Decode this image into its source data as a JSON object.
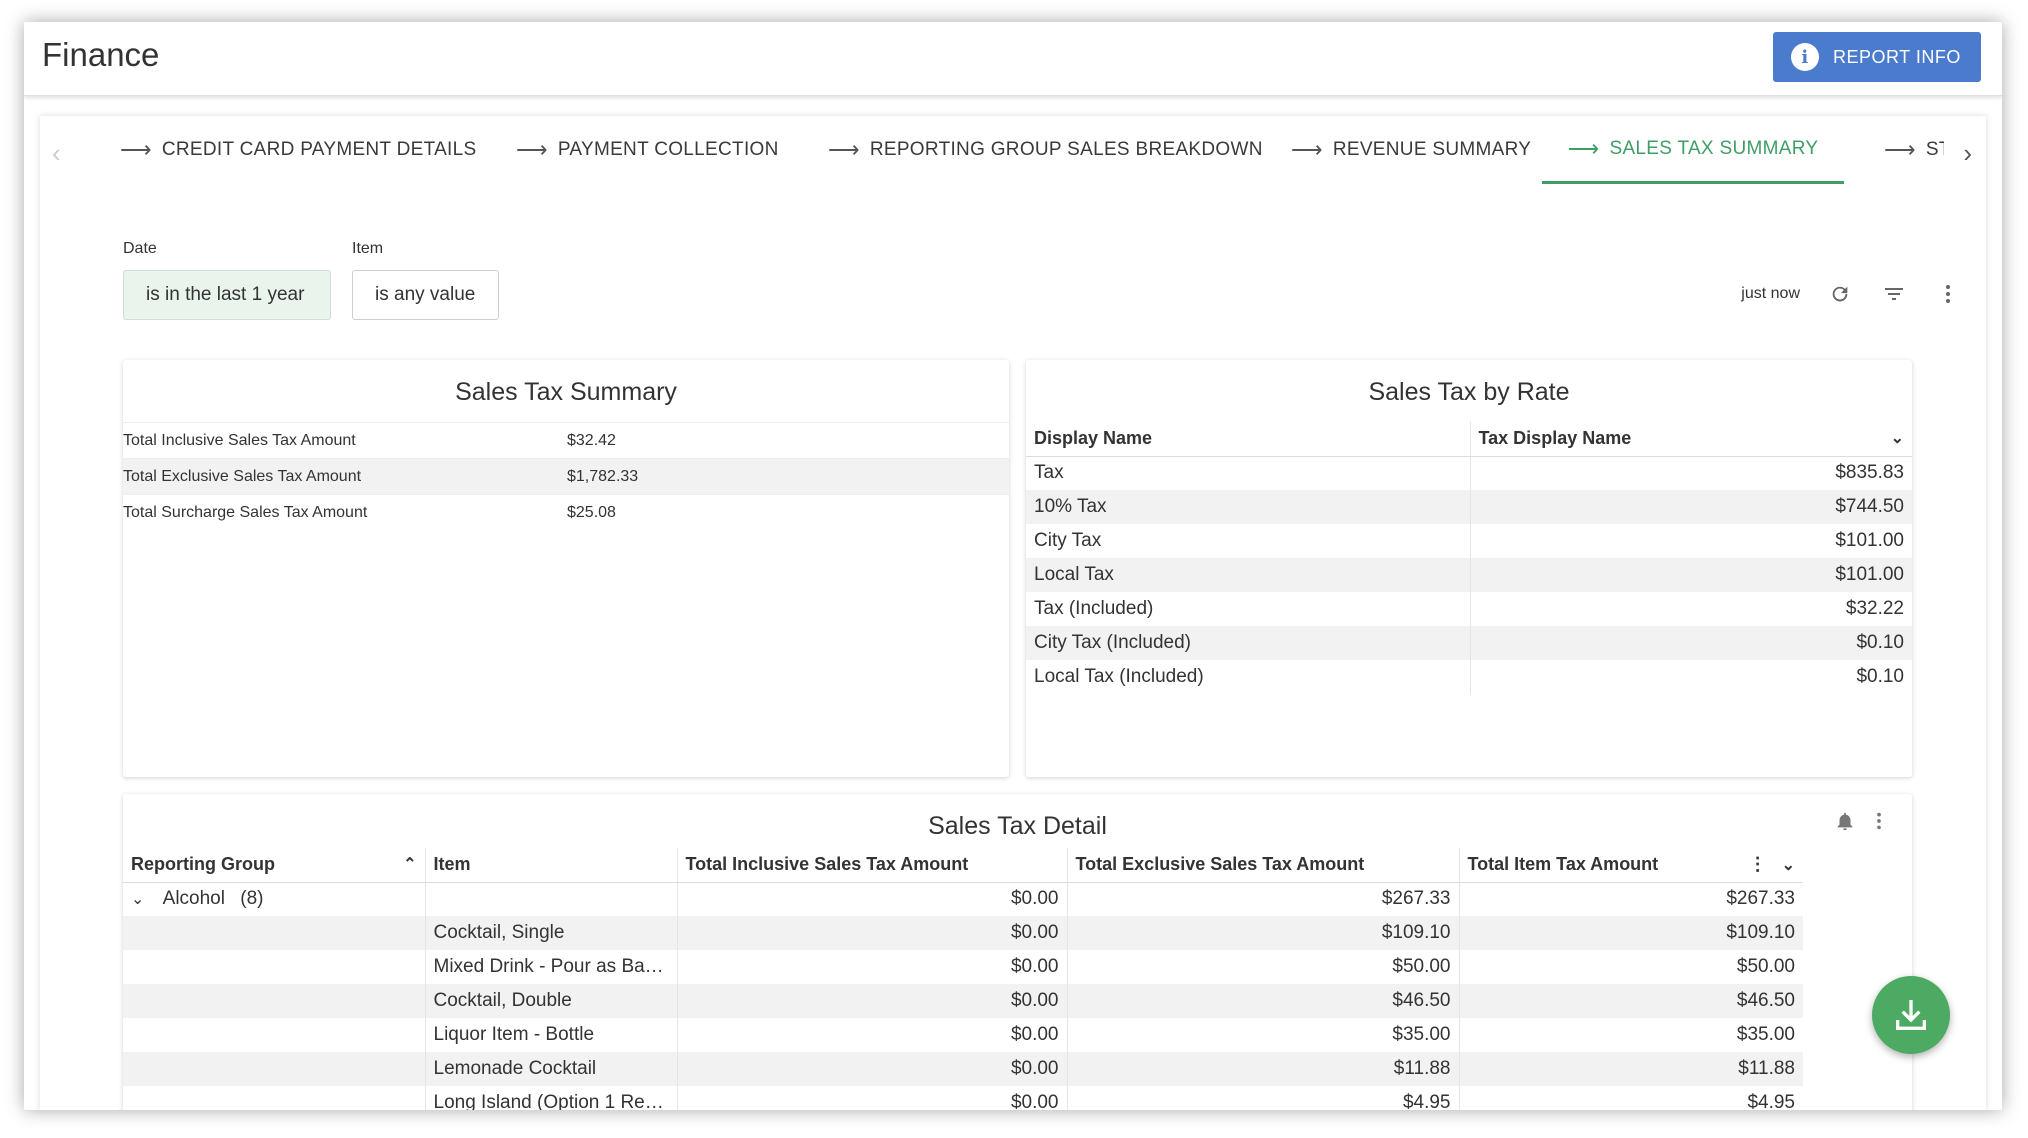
{
  "app": {
    "title": "Finance",
    "report_info_label": "REPORT INFO"
  },
  "tabs": [
    {
      "label": "CREDIT CARD PAYMENT DETAILS"
    },
    {
      "label": "PAYMENT COLLECTION"
    },
    {
      "label": "REPORTING GROUP SALES BREAKDOWN"
    },
    {
      "label": "REVENUE SUMMARY"
    },
    {
      "label": "SALES TAX SUMMARY",
      "active": true
    },
    {
      "label": "STC"
    }
  ],
  "filters": {
    "date": {
      "label": "Date",
      "value": "is in the last 1 year"
    },
    "item": {
      "label": "Item",
      "value": "is any value"
    }
  },
  "toolbar": {
    "updated": "just now"
  },
  "summary": {
    "title": "Sales Tax Summary",
    "rows": [
      {
        "label": "Total Inclusive Sales Tax Amount",
        "value": "$32.42"
      },
      {
        "label": "Total Exclusive Sales Tax Amount",
        "value": "$1,782.33"
      },
      {
        "label": "Total Surcharge Sales Tax Amount",
        "value": "$25.08"
      }
    ]
  },
  "by_rate": {
    "title": "Sales Tax by Rate",
    "headers": [
      "Display Name",
      "Tax Display Name"
    ],
    "rows": [
      {
        "name": "Tax",
        "value": "$835.83"
      },
      {
        "name": "10% Tax",
        "value": "$744.50"
      },
      {
        "name": "City Tax",
        "value": "$101.00"
      },
      {
        "name": "Local Tax",
        "value": "$101.00"
      },
      {
        "name": "Tax (Included)",
        "value": "$32.22"
      },
      {
        "name": "City Tax (Included)",
        "value": "$0.10"
      },
      {
        "name": "Local Tax (Included)",
        "value": "$0.10"
      }
    ]
  },
  "detail": {
    "title": "Sales Tax Detail",
    "headers": [
      "Reporting Group",
      "Item",
      "Total Inclusive Sales Tax Amount",
      "Total Exclusive Sales Tax Amount",
      "Total Item Tax Amount"
    ],
    "group": {
      "name": "Alcohol",
      "count": "(8)",
      "inclusive": "$0.00",
      "exclusive": "$267.33",
      "total": "$267.33"
    },
    "rows": [
      {
        "item": "Cocktail, Single",
        "inclusive": "$0.00",
        "exclusive": "$109.10",
        "total": "$109.10"
      },
      {
        "item": "Mixed Drink - Pour as Ba…",
        "inclusive": "$0.00",
        "exclusive": "$50.00",
        "total": "$50.00"
      },
      {
        "item": "Cocktail, Double",
        "inclusive": "$0.00",
        "exclusive": "$46.50",
        "total": "$46.50"
      },
      {
        "item": "Liquor Item - Bottle",
        "inclusive": "$0.00",
        "exclusive": "$35.00",
        "total": "$35.00"
      },
      {
        "item": "Lemonade Cocktail",
        "inclusive": "$0.00",
        "exclusive": "$11.88",
        "total": "$11.88"
      },
      {
        "item": "Long Island (Option 1 Re…",
        "inclusive": "$0.00",
        "exclusive": "$4.95",
        "total": "$4.95"
      }
    ]
  },
  "colors": {
    "accent": "#3f9e66",
    "button": "#4a7bcc",
    "fab": "#4caa63"
  }
}
